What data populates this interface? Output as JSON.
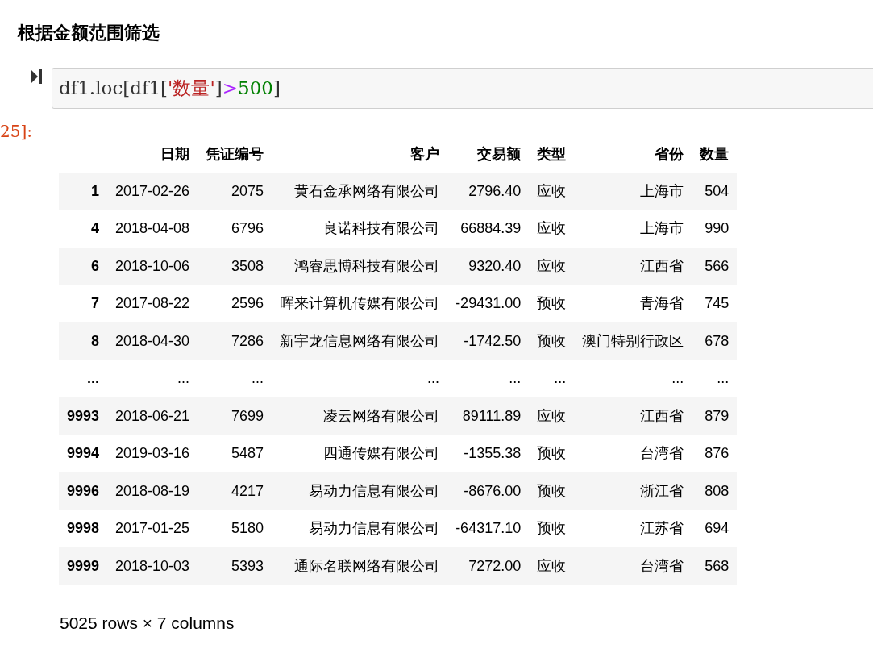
{
  "heading": "根据金额范围筛选",
  "cell": {
    "prompt": "25]:",
    "code": [
      {
        "kind": "plain",
        "text": "df1.loc[df1["
      },
      {
        "kind": "string",
        "text": "'数量'"
      },
      {
        "kind": "plain",
        "text": "]"
      },
      {
        "kind": "operator",
        "text": ">"
      },
      {
        "kind": "number",
        "text": "500"
      },
      {
        "kind": "plain",
        "text": "]"
      }
    ]
  },
  "table": {
    "columns": [
      "",
      "日期",
      "凭证编号",
      "客户",
      "交易额",
      "类型",
      "省份",
      "数量"
    ],
    "rows": [
      [
        "1",
        "2017-02-26",
        "2075",
        "黄石金承网络有限公司",
        "2796.40",
        "应收",
        "上海市",
        "504"
      ],
      [
        "4",
        "2018-04-08",
        "6796",
        "良诺科技有限公司",
        "66884.39",
        "应收",
        "上海市",
        "990"
      ],
      [
        "6",
        "2018-10-06",
        "3508",
        "鸿睿思博科技有限公司",
        "9320.40",
        "应收",
        "江西省",
        "566"
      ],
      [
        "7",
        "2017-08-22",
        "2596",
        "晖来计算机传媒有限公司",
        "-29431.00",
        "预收",
        "青海省",
        "745"
      ],
      [
        "8",
        "2018-04-30",
        "7286",
        "新宇龙信息网络有限公司",
        "-1742.50",
        "预收",
        "澳门特别行政区",
        "678"
      ],
      [
        "...",
        "...",
        "...",
        "...",
        "...",
        "...",
        "...",
        "..."
      ],
      [
        "9993",
        "2018-06-21",
        "7699",
        "凌云网络有限公司",
        "89111.89",
        "应收",
        "江西省",
        "879"
      ],
      [
        "9994",
        "2019-03-16",
        "5487",
        "四通传媒有限公司",
        "-1355.38",
        "预收",
        "台湾省",
        "876"
      ],
      [
        "9996",
        "2018-08-19",
        "4217",
        "易动力信息有限公司",
        "-8676.00",
        "预收",
        "浙江省",
        "808"
      ],
      [
        "9998",
        "2017-01-25",
        "5180",
        "易动力信息有限公司",
        "-64317.10",
        "预收",
        "江苏省",
        "694"
      ],
      [
        "9999",
        "2018-10-03",
        "5393",
        "通际名联网络有限公司",
        "7272.00",
        "应收",
        "台湾省",
        "568"
      ]
    ]
  },
  "footer": "5025 rows × 7 columns"
}
